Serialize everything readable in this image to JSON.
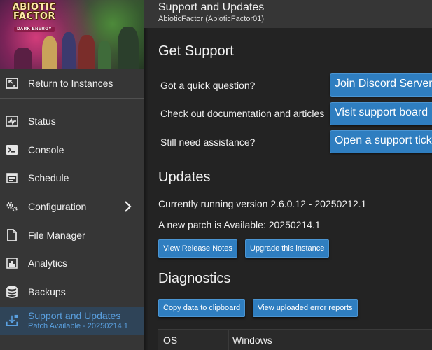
{
  "banner": {
    "logo_line1": "ABIOTIC",
    "logo_line2": "FACTOR",
    "logo_sub": "DARK ENERGY"
  },
  "sidebar": {
    "return_label": "Return to Instances",
    "items": [
      {
        "label": "Status",
        "icon": "status-icon"
      },
      {
        "label": "Console",
        "icon": "console-icon"
      },
      {
        "label": "Schedule",
        "icon": "schedule-icon"
      },
      {
        "label": "Configuration",
        "icon": "gear-icon"
      },
      {
        "label": "File Manager",
        "icon": "file-icon"
      },
      {
        "label": "Analytics",
        "icon": "analytics-icon"
      },
      {
        "label": "Backups",
        "icon": "database-icon"
      },
      {
        "label": "Support and Updates",
        "sublabel": "Patch Available - 20250214.1",
        "icon": "download-icon",
        "active": true
      }
    ]
  },
  "header": {
    "title": "Support and Updates",
    "subtitle": "AbioticFactor (AbioticFactor01)"
  },
  "support": {
    "heading": "Get Support",
    "rows": [
      {
        "question": "Got a quick question?",
        "button": "Join Discord Server"
      },
      {
        "question": "Check out documentation and articles",
        "button": "Visit support board"
      },
      {
        "question": "Still need assistance?",
        "button": "Open a support ticket"
      }
    ]
  },
  "updates": {
    "heading": "Updates",
    "current": "Currently running version 2.6.0.12 - 20250212.1",
    "patch": "A new patch is Available: 20250214.1",
    "release_notes_btn": "View Release Notes",
    "upgrade_btn": "Upgrade this instance"
  },
  "diagnostics": {
    "heading": "Diagnostics",
    "copy_btn": "Copy data to clipboard",
    "reports_btn": "View uploaded error reports",
    "rows": [
      {
        "key": "OS",
        "value": "Windows"
      }
    ]
  },
  "colors": {
    "accent": "#2f7ec0",
    "active_text": "#5aa0e0",
    "sidebar_bg": "#363636",
    "main_bg": "#232323"
  }
}
